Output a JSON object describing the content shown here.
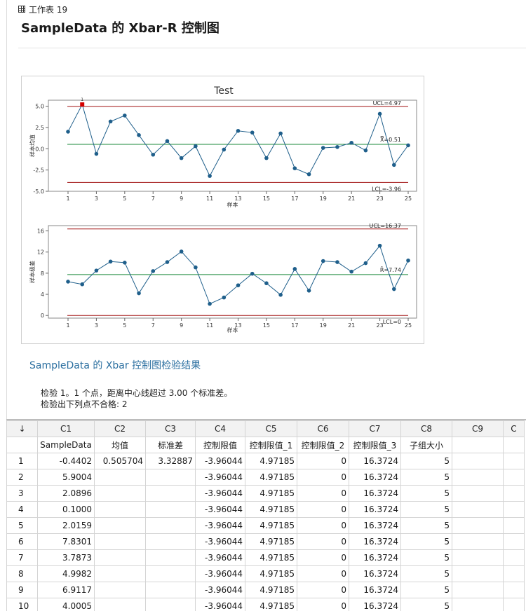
{
  "header": {
    "worksheet_label": "工作表 19",
    "title": "SampleData 的 Xbar-R 控制图"
  },
  "chart_data": [
    {
      "type": "line",
      "title": "Test",
      "xlabel": "样本",
      "ylabel": "样本均值",
      "x": [
        1,
        2,
        3,
        4,
        5,
        6,
        7,
        8,
        9,
        10,
        11,
        12,
        13,
        14,
        15,
        16,
        17,
        18,
        19,
        20,
        21,
        22,
        23,
        24,
        25
      ],
      "values": [
        2.0,
        5.2,
        -0.6,
        3.2,
        3.9,
        1.6,
        -0.7,
        0.9,
        -1.1,
        0.3,
        -3.2,
        -0.1,
        2.1,
        1.9,
        -1.1,
        1.8,
        -2.3,
        -3.0,
        0.1,
        0.2,
        0.7,
        -0.2,
        4.1,
        -1.9,
        0.4
      ],
      "ylim": [
        -5.0,
        5.7
      ],
      "yticks": [
        "5.0",
        "2.5",
        "0.0",
        "-2.5",
        "-5.0"
      ],
      "ytick_values": [
        5.0,
        2.5,
        0.0,
        -2.5,
        -5.0
      ],
      "xticks": [
        "1",
        "3",
        "5",
        "7",
        "9",
        "11",
        "13",
        "15",
        "17",
        "19",
        "21",
        "23",
        "25"
      ],
      "reference_lines": {
        "ucl": 4.97,
        "center": 0.51,
        "lcl": -3.96
      },
      "ucl_label": "UCL=4.97",
      "center_label": "X̿=0.51",
      "lcl_label": "LCL=-3.96",
      "flagged_points": [
        2
      ],
      "flag_label": "1"
    },
    {
      "type": "line",
      "xlabel": "样本",
      "ylabel": "样本极差",
      "x": [
        1,
        2,
        3,
        4,
        5,
        6,
        7,
        8,
        9,
        10,
        11,
        12,
        13,
        14,
        15,
        16,
        17,
        18,
        19,
        20,
        21,
        22,
        23,
        24,
        25
      ],
      "values": [
        6.4,
        5.9,
        8.5,
        10.2,
        10.0,
        4.2,
        8.4,
        10.1,
        12.1,
        9.1,
        2.2,
        3.4,
        5.7,
        7.9,
        6.1,
        3.9,
        8.8,
        4.7,
        10.3,
        10.1,
        8.3,
        9.9,
        13.2,
        5.0,
        10.4
      ],
      "ylim": [
        -0.5,
        17.0
      ],
      "yticks": [
        "16",
        "12",
        "8",
        "4",
        "0"
      ],
      "ytick_values": [
        16,
        12,
        8,
        4,
        0
      ],
      "xticks": [
        "1",
        "3",
        "5",
        "7",
        "9",
        "11",
        "13",
        "15",
        "17",
        "19",
        "21",
        "23",
        "25"
      ],
      "reference_lines": {
        "ucl": 16.37,
        "center": 7.74,
        "lcl": 0
      },
      "ucl_label": "UCL=16.37",
      "center_label": "R̄=7.74",
      "lcl_label": "LCL=0"
    }
  ],
  "chart_colors": {
    "series": "#1f5f8b",
    "limits": "#a01010",
    "center": "#1a8a3a",
    "flag": "#d40000"
  },
  "results": {
    "title": "SampleData 的 Xbar 控制图检验结果",
    "line1": "检验 1。1 个点，距离中心线超过 3.00 个标准差。",
    "line2": "检验出下列点不合格:  2"
  },
  "worksheet": {
    "corner_icon": "down-arrow-icon",
    "columns": [
      "C1",
      "C2",
      "C3",
      "C4",
      "C5",
      "C6",
      "C7",
      "C8",
      "C9",
      "C"
    ],
    "names": [
      "SampleData",
      "均值",
      "标准差",
      "控制限值",
      "控制限值_1",
      "控制限值_2",
      "控制限值_3",
      "子组大小",
      "",
      ""
    ],
    "rows": [
      [
        "1",
        "-0.4402",
        "0.505704",
        "3.32887",
        "-3.96044",
        "4.97185",
        "0",
        "16.3724",
        "5",
        "",
        ""
      ],
      [
        "2",
        "5.9004",
        "",
        "",
        "-3.96044",
        "4.97185",
        "0",
        "16.3724",
        "5",
        "",
        ""
      ],
      [
        "3",
        "2.0896",
        "",
        "",
        "-3.96044",
        "4.97185",
        "0",
        "16.3724",
        "5",
        "",
        ""
      ],
      [
        "4",
        "0.1000",
        "",
        "",
        "-3.96044",
        "4.97185",
        "0",
        "16.3724",
        "5",
        "",
        ""
      ],
      [
        "5",
        "2.0159",
        "",
        "",
        "-3.96044",
        "4.97185",
        "0",
        "16.3724",
        "5",
        "",
        ""
      ],
      [
        "6",
        "7.8301",
        "",
        "",
        "-3.96044",
        "4.97185",
        "0",
        "16.3724",
        "5",
        "",
        ""
      ],
      [
        "7",
        "3.7873",
        "",
        "",
        "-3.96044",
        "4.97185",
        "0",
        "16.3724",
        "5",
        "",
        ""
      ],
      [
        "8",
        "4.9982",
        "",
        "",
        "-3.96044",
        "4.97185",
        "0",
        "16.3724",
        "5",
        "",
        ""
      ],
      [
        "9",
        "6.9117",
        "",
        "",
        "-3.96044",
        "4.97185",
        "0",
        "16.3724",
        "5",
        "",
        ""
      ],
      [
        "10",
        "4.0005",
        "",
        "",
        "-3.96044",
        "4.97185",
        "0",
        "16.3724",
        "5",
        "",
        ""
      ]
    ]
  }
}
